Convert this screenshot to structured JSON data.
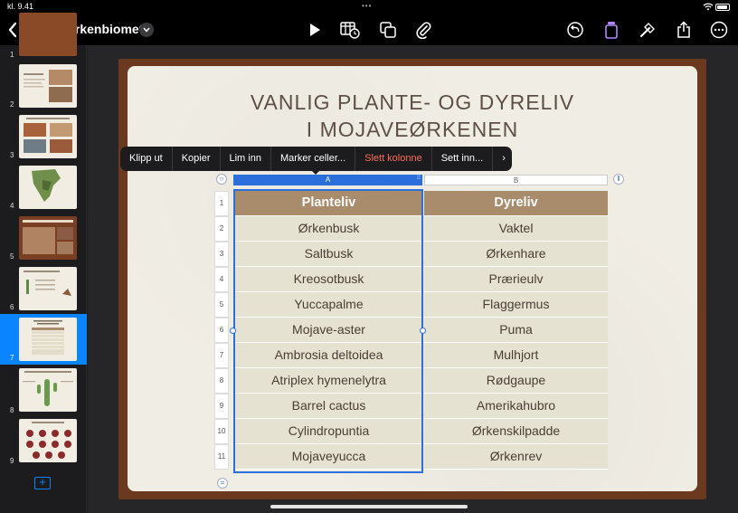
{
  "status_bar": {
    "time": "kl. 9.41",
    "dots": "•••"
  },
  "toolbar": {
    "document_title": "Ørkenbiomet"
  },
  "sidebar": {
    "slides": [
      {
        "number": "1"
      },
      {
        "number": "2"
      },
      {
        "number": "3"
      },
      {
        "number": "4"
      },
      {
        "number": "5"
      },
      {
        "number": "6"
      },
      {
        "number": "7",
        "selected": true
      },
      {
        "number": "8"
      },
      {
        "number": "9"
      }
    ],
    "add_label": "+"
  },
  "slide": {
    "title_line1": "VANLIG PLANTE- OG DYRELIV",
    "title_line2": "I MOJAVEØRKENEN"
  },
  "context_menu": {
    "items": [
      "Klipp ut",
      "Kopier",
      "Lim inn",
      "Marker celler...",
      "Slett kolonne",
      "Sett inn..."
    ],
    "more": "›"
  },
  "table": {
    "column_letters": [
      "A",
      "B"
    ],
    "row_numbers": [
      "1",
      "2",
      "3",
      "4",
      "5",
      "6",
      "7",
      "8",
      "9",
      "10",
      "11"
    ],
    "headers": [
      "Planteliv",
      "Dyreliv"
    ],
    "rows": [
      [
        "Ørkenbusk",
        "Vaktel"
      ],
      [
        "Saltbusk",
        "Ørkenhare"
      ],
      [
        "Kreosotbusk",
        "Prærieulv"
      ],
      [
        "Yuccapalme",
        "Flaggermus"
      ],
      [
        "Mojave-aster",
        "Puma"
      ],
      [
        "Ambrosia deltoidea",
        "Mulhjort"
      ],
      [
        "Atriplex hymenelytra",
        "Rødgaupe"
      ],
      [
        "Barrel cactus",
        "Amerikahubro"
      ],
      [
        "Cylindropuntia",
        "Ørkenskilpadde"
      ],
      [
        "Mojaveyucca",
        "Ørkenrev"
      ]
    ]
  },
  "colors": {
    "accent": "#0a84ff",
    "selection": "#2a6fdb",
    "header_cell": "#a88c6c",
    "body_cell": "#e6e2d2",
    "delete": "#ff6b5a",
    "slide_frame": "#6b3a1e"
  }
}
